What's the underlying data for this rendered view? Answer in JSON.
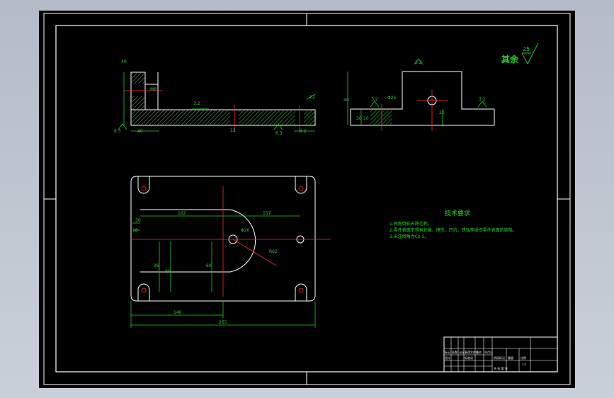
{
  "colors": {
    "background": "#000000",
    "outline": "#ffffff",
    "dimension": "#20d020",
    "centerline": "#ff2a2a",
    "hatch": "#2ee32e",
    "frame_outer": "#ffffff",
    "desktop": "#b8c0cc"
  },
  "roughness": {
    "note": "其余",
    "value": "25"
  },
  "technical_requirements": {
    "title": "技术要求",
    "items": [
      "1.锐角倒钝去除毛刺。",
      "2.零件表面不得有划痕、擦伤、凹坑、锈蚀等损伤零件表面的缺陷。",
      "3.未注倒角为C0.5。"
    ]
  },
  "dimensions": {
    "side_view": {
      "d1": "40",
      "d2": "3.2",
      "d3": "M8",
      "d4": "12",
      "d5": "6.3",
      "d6": "6.3",
      "d7": "40",
      "d8": "22",
      "d9": "3.2"
    },
    "front_view": {
      "height": "40",
      "r1": "3.2",
      "r2": "3.2",
      "r3": "3.2",
      "w1": "30",
      "w2": "10",
      "w3": "20",
      "bore": "Φ25"
    },
    "plan_view": {
      "top": "162",
      "right": "157",
      "left": "18",
      "l2": "30",
      "h1": "26",
      "h2": "60",
      "hole": "Φ20",
      "radial": "R62",
      "bottom1": "140",
      "bottom2": "265",
      "mid": "60"
    }
  },
  "title_block": {
    "row_labels": [
      "标记",
      "处数",
      "分区",
      "更改文件号",
      "签名",
      "年月日"
    ],
    "designer_row": "设计",
    "std_row": "标准化",
    "stage_label": "阶段标记",
    "weight_label": "重量",
    "scale_label": "比例",
    "scale_value": "1:1",
    "sheet_label": "共 张 第 张"
  }
}
